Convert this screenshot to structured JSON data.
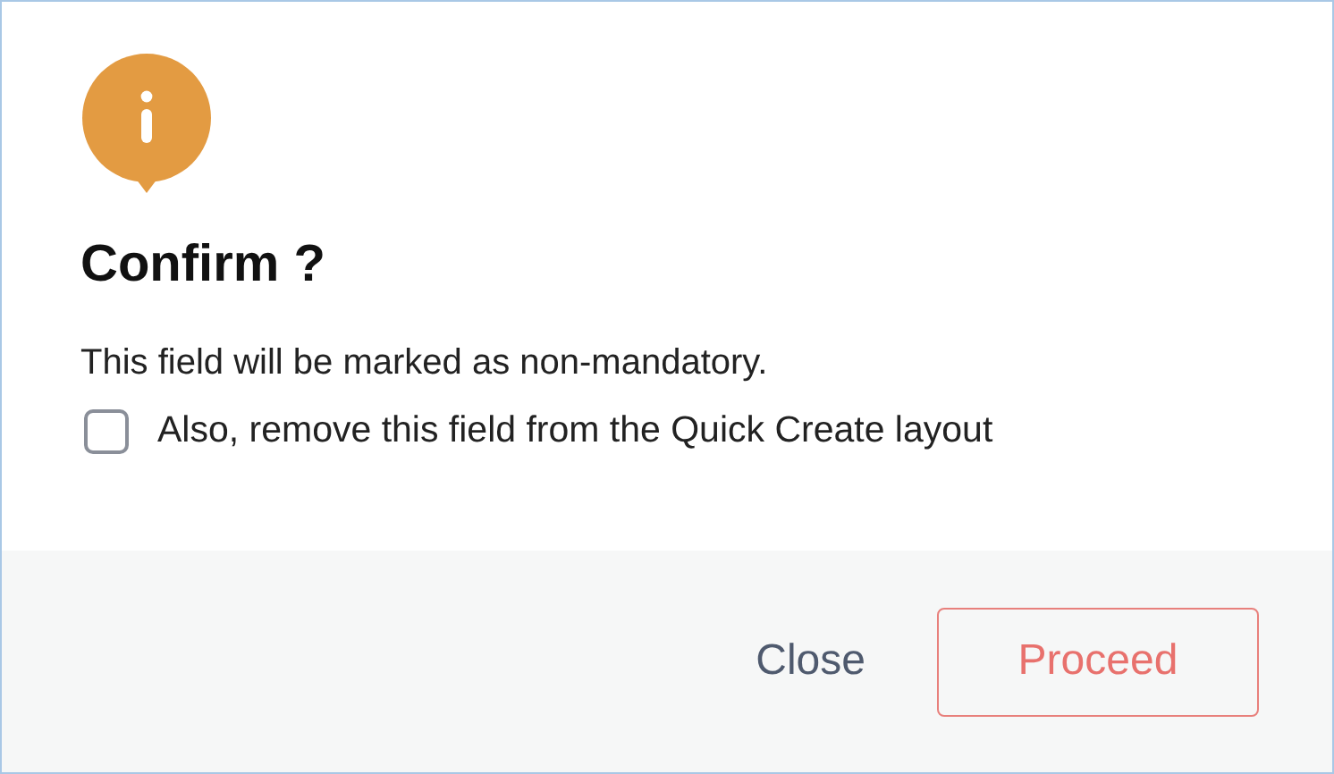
{
  "dialog": {
    "title": "Confirm ?",
    "message": "This field will be marked as non-mandatory.",
    "checkbox": {
      "label": "Also, remove this field from the Quick Create layout",
      "checked": false
    },
    "buttons": [
      {
        "label": "Close",
        "kind": "text"
      },
      {
        "label": "Proceed",
        "kind": "outline"
      }
    ]
  }
}
